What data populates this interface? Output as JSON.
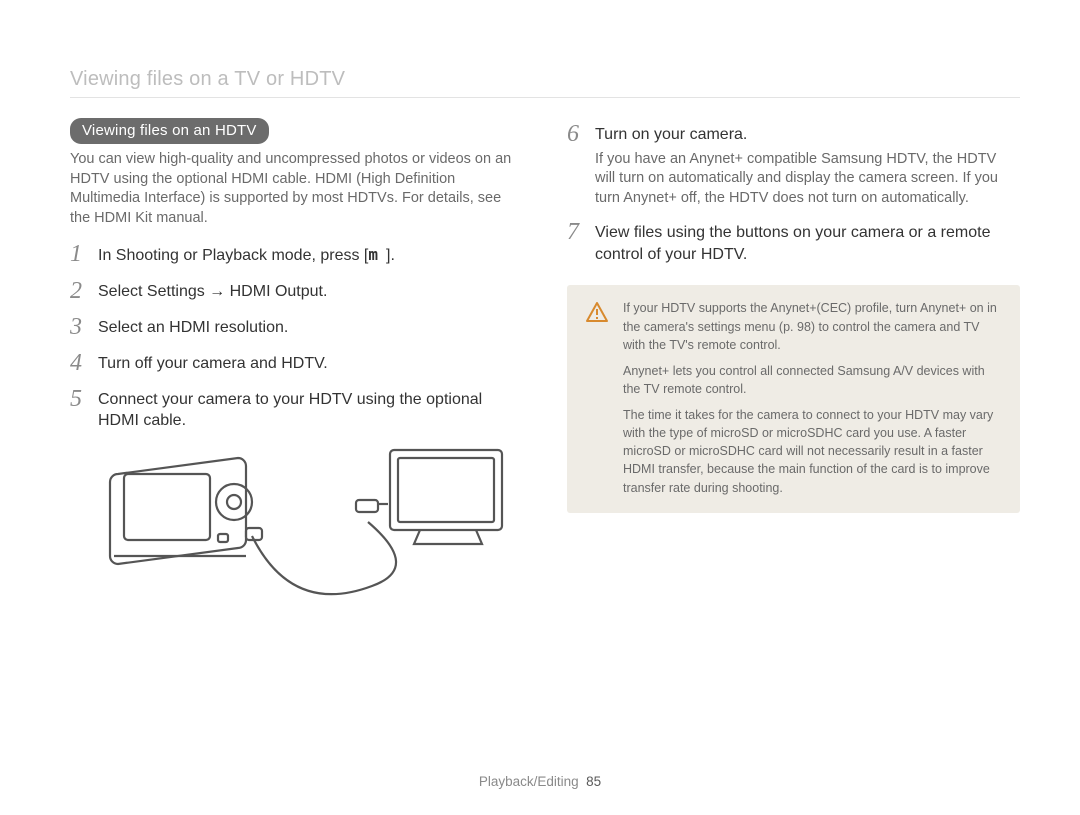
{
  "topicTitle": "Viewing files on a TV or HDTV",
  "sectionPill": "Viewing files on an HDTV",
  "intro": "You can view high-quality and uncompressed photos or videos on an HDTV using the optional HDMI cable. HDMI (High Definition Multimedia Interface) is supported by most HDTVs. For details, see the HDMI Kit manual.",
  "steps_left": [
    {
      "n": "1",
      "text_pre": "In Shooting or Playback mode, press [",
      "icon": "m",
      "text_post": "]."
    },
    {
      "n": "2",
      "text_pre": "Select ",
      "bold": "Settings → HDMI Output",
      "text_post": "."
    },
    {
      "n": "3",
      "text": "Select an HDMI resolution."
    },
    {
      "n": "4",
      "text": "Turn off your camera and HDTV."
    },
    {
      "n": "5",
      "text": "Connect your camera to your HDTV using the optional HDMI cable."
    }
  ],
  "steps_right": [
    {
      "n": "6",
      "text": "Turn on your camera.",
      "sub": "If you have an Anynet+ compatible Samsung HDTV, the HDTV will turn on automatically and display the camera screen. If you turn Anynet+ off, the HDTV does not turn on automatically."
    },
    {
      "n": "7",
      "text": "View files using the buttons on your camera or a remote control of your HDTV."
    }
  ],
  "notes": [
    "If your HDTV supports the Anynet+(CEC) profile, turn Anynet+ on in the camera's settings menu (p. 98) to control the camera and TV with the TV's remote control.",
    "Anynet+ lets you control all connected Samsung A/V devices with the TV remote control.",
    "The time it takes for the camera to connect to your HDTV may vary with the type of microSD or microSDHC card you use. A faster microSD or microSDHC card will not necessarily result in a faster HDMI transfer, because the main function of the card is to improve transfer rate during shooting."
  ],
  "footer": {
    "section": "Playback/Editing",
    "page": "85"
  }
}
